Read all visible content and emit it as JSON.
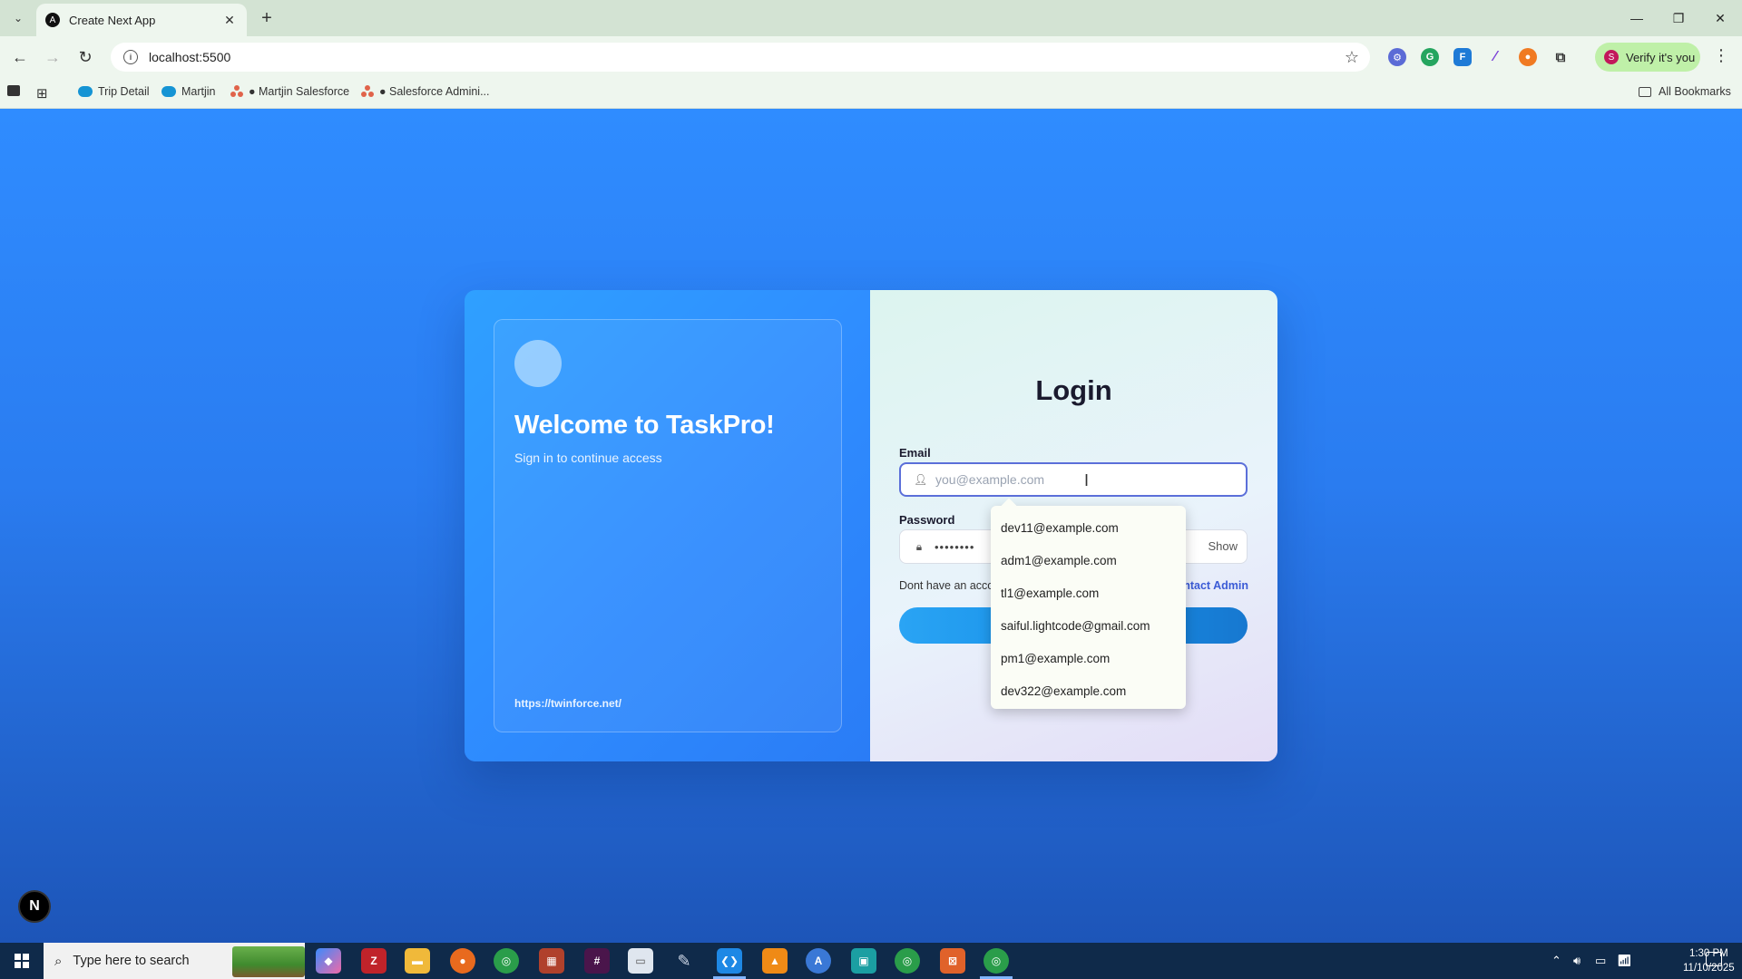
{
  "browser": {
    "tab_title": "Create Next App",
    "tab_favicon": "A",
    "url": "localhost:5500",
    "verify_label": "Verify it's you",
    "verify_avatar": "S",
    "bookmarks": [
      {
        "label": "Trip Detail",
        "icon": "salesforce-cloud-icon"
      },
      {
        "label": "Martjin",
        "icon": "salesforce-cloud-icon"
      },
      {
        "label": "● Martjin Salesforce",
        "icon": "trailhead-dots-icon"
      },
      {
        "label": "● Salesforce Admini...",
        "icon": "trailhead-dots-icon"
      }
    ],
    "all_bookmarks": "All Bookmarks"
  },
  "left_panel": {
    "welcome": "Welcome to TaskPro!",
    "subtitle": "Sign in to continue access",
    "link": "https://twinforce.net/"
  },
  "login": {
    "title": "Login",
    "email_label": "Email",
    "email_placeholder": "you@example.com",
    "password_label": "Password",
    "password_masked": "••••••••",
    "show_label": "Show",
    "signup_text": "Dont have an acco",
    "contact_admin": "ontact Admin"
  },
  "autocomplete": {
    "suggestions": [
      "dev11@example.com",
      "adm1@example.com",
      "tl1@example.com",
      "saiful.lightcode@gmail.com",
      "pm1@example.com",
      "dev322@example.com"
    ]
  },
  "next_badge": "N",
  "taskbar": {
    "search_placeholder": "Type here to search",
    "time": "1:30 PM",
    "date": "11/10/2025"
  },
  "colors": {
    "page_bg": "#2f8cff",
    "accent": "#5b6fd9",
    "login_button": "#1790e8",
    "contact_link": "#3b5bd6"
  }
}
